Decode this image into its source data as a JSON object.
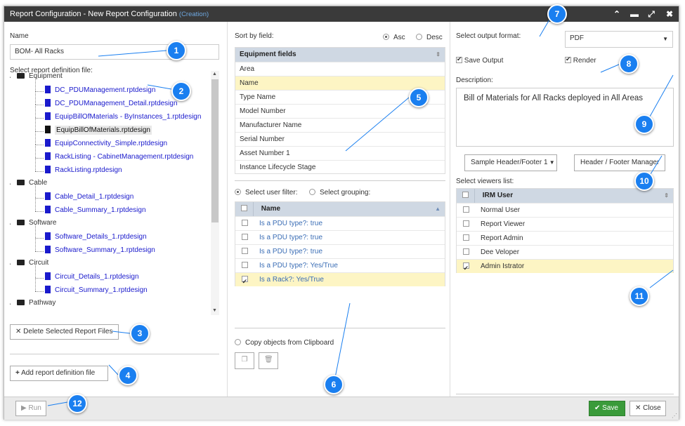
{
  "window": {
    "title": "Report Configuration - New Report Configuration",
    "mode": "(Creation)"
  },
  "left": {
    "name_label": "Name",
    "name_value": "BOM- All Racks",
    "definition_label": "Select report definition file:",
    "tree": [
      {
        "type": "folder",
        "label": "Equipment"
      },
      {
        "type": "file",
        "label": "DC_PDUManagement.rptdesign"
      },
      {
        "type": "file",
        "label": "DC_PDUManagement_Detail.rptdesign"
      },
      {
        "type": "file",
        "label": "EquipBillOfMaterials - ByInstances_1.rptdesign"
      },
      {
        "type": "file",
        "label": "EquipBillOfMaterials.rptdesign",
        "selected": true
      },
      {
        "type": "file",
        "label": "EquipConnectivity_Simple.rptdesign"
      },
      {
        "type": "file",
        "label": "RackListing - CabinetManagement.rptdesign"
      },
      {
        "type": "file",
        "label": "RackListing.rptdesign"
      },
      {
        "type": "folder",
        "label": "Cable"
      },
      {
        "type": "file",
        "label": "Cable_Detail_1.rptdesign"
      },
      {
        "type": "file",
        "label": "Cable_Summary_1.rptdesign"
      },
      {
        "type": "folder",
        "label": "Software"
      },
      {
        "type": "file",
        "label": "Software_Details_1.rptdesign"
      },
      {
        "type": "file",
        "label": "Software_Summary_1.rptdesign"
      },
      {
        "type": "folder",
        "label": "Circuit"
      },
      {
        "type": "file",
        "label": "Circuit_Details_1.rptdesign"
      },
      {
        "type": "file",
        "label": "Circuit_Summary_1.rptdesign"
      },
      {
        "type": "folder",
        "label": "Pathway"
      }
    ],
    "delete_label": "Delete Selected Report Files",
    "add_label": "Add report definition file"
  },
  "middle": {
    "sort_label": "Sort by field:",
    "asc_label": "Asc",
    "desc_label": "Desc",
    "fields_header": "Equipment fields",
    "fields": [
      "Area",
      "Name",
      "Type Name",
      "Model Number",
      "Manufacturer Name",
      "Serial Number",
      "Asset Number 1",
      "Instance Lifecycle Stage"
    ],
    "filter_label": "Select user filter:",
    "grouping_label": "Select grouping:",
    "filter_header": "Name",
    "filters": [
      {
        "label": "Is a PDU type?: true",
        "checked": false
      },
      {
        "label": "Is a PDU type?: true",
        "checked": false
      },
      {
        "label": "Is a PDU type?: true",
        "checked": false
      },
      {
        "label": "Is a PDU type?: Yes/True",
        "checked": false
      },
      {
        "label": "Is a Rack?: Yes/True",
        "checked": true
      }
    ],
    "copy_label": "Copy objects from Clipboard"
  },
  "right": {
    "format_label": "Select output format:",
    "format_value": "PDF",
    "save_output_label": "Save Output",
    "render_label": "Render",
    "description_label": "Description:",
    "description_value": "Bill of Materials for All Racks deployed in All Areas",
    "header_select": "Sample Header/Footer 1",
    "header_manager": "Header / Footer Manager",
    "viewers_label": "Select viewers list:",
    "viewers_header": "IRM User",
    "viewers": [
      {
        "label": "Normal User",
        "checked": false
      },
      {
        "label": "Report Viewer",
        "checked": false
      },
      {
        "label": "Report Admin",
        "checked": false
      },
      {
        "label": "Dee Veloper",
        "checked": false
      },
      {
        "label": "Admin Istrator",
        "checked": true
      }
    ]
  },
  "footer": {
    "run_label": "Run",
    "save_label": "Save",
    "close_label": "Close"
  },
  "callouts": [
    "1",
    "2",
    "3",
    "4",
    "5",
    "6",
    "7",
    "8",
    "9",
    "10",
    "11",
    "12"
  ],
  "colors": {
    "accent": "#1a7ff0",
    "save": "#3a9b3a",
    "titlebar": "#3a3a3a",
    "highlight": "#fdf5c4"
  }
}
